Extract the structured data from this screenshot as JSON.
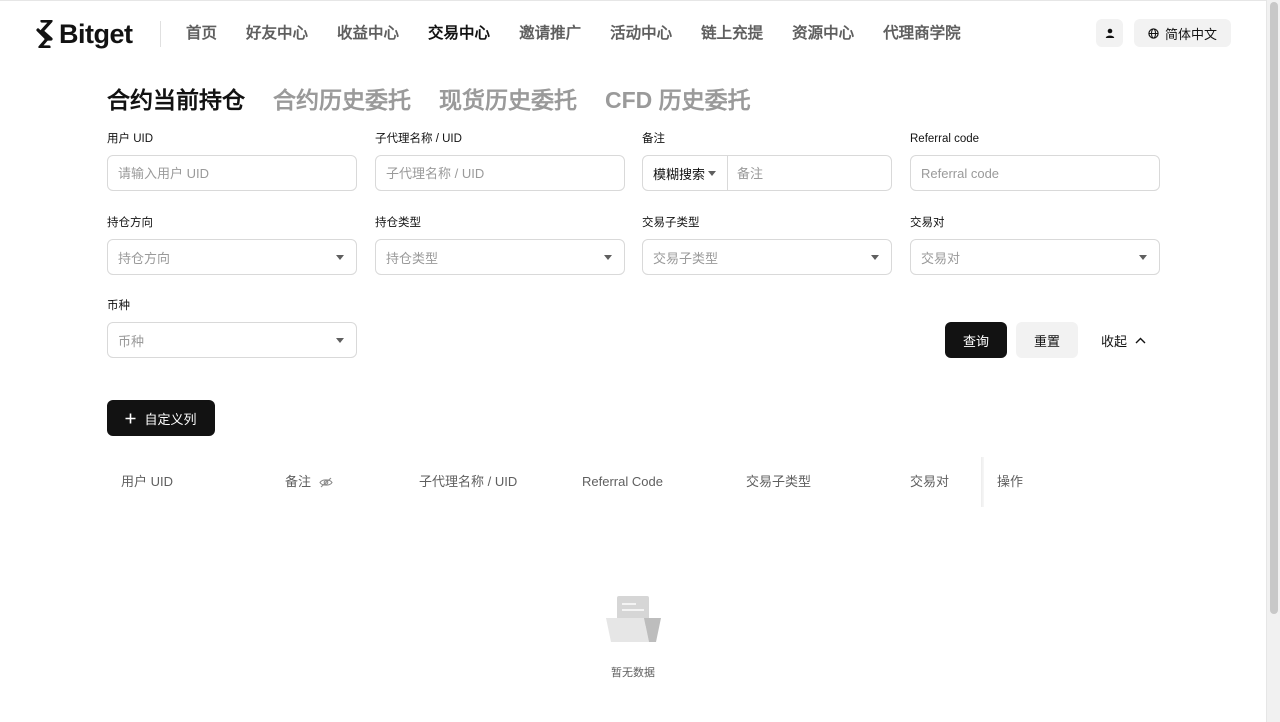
{
  "brand": {
    "name": "Bitget"
  },
  "nav": {
    "items": [
      "首页",
      "好友中心",
      "收益中心",
      "交易中心",
      "邀请推广",
      "活动中心",
      "链上充提",
      "资源中心",
      "代理商学院"
    ],
    "active_index": 3
  },
  "header": {
    "language_label": "简体中文"
  },
  "tabs": {
    "items": [
      "合约当前持仓",
      "合约历史委托",
      "现货历史委托",
      "CFD 历史委托"
    ],
    "active_index": 0
  },
  "filters": {
    "user_uid": {
      "label": "用户 UID",
      "placeholder": "请输入用户 UID"
    },
    "sub_agent": {
      "label": "子代理名称 / UID",
      "placeholder": "子代理名称 / UID"
    },
    "remark": {
      "label": "备注",
      "mode_value": "模糊搜索",
      "placeholder": "备注"
    },
    "referral_code": {
      "label": "Referral code",
      "placeholder": "Referral code"
    },
    "position_side": {
      "label": "持仓方向",
      "placeholder": "持仓方向"
    },
    "position_type": {
      "label": "持仓类型",
      "placeholder": "持仓类型"
    },
    "trade_subtype": {
      "label": "交易子类型",
      "placeholder": "交易子类型"
    },
    "trade_pair": {
      "label": "交易对",
      "placeholder": "交易对"
    },
    "currency": {
      "label": "币种",
      "placeholder": "币种"
    }
  },
  "actions": {
    "query_label": "查询",
    "reset_label": "重置",
    "collapse_label": "收起",
    "custom_columns_label": "自定义列"
  },
  "table": {
    "columns": [
      "用户 UID",
      "备注",
      "子代理名称 / UID",
      "Referral Code",
      "交易子类型",
      "交易对",
      "操作"
    ],
    "empty_text": "暂无数据"
  }
}
